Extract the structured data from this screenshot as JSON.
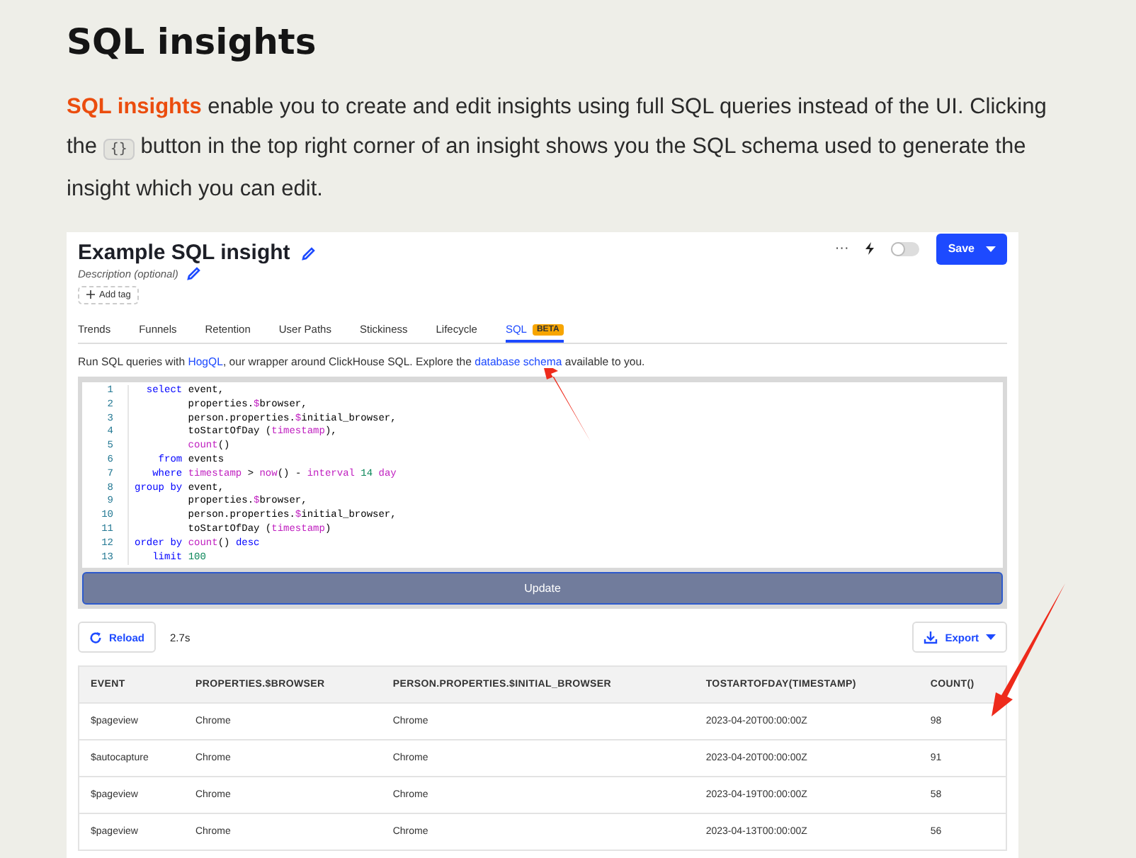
{
  "heading": "SQL insights",
  "intro": {
    "link": "SQL insights",
    "text_1": " enable you to create and edit insights using full SQL queries instead of the UI. Clicking the ",
    "code": "{}",
    "text_2": " button in the top right corner of an insight shows you the SQL schema used to generate the insight which you can edit."
  },
  "insight": {
    "title": "Example SQL insight",
    "description_placeholder": "Description (optional)",
    "add_tag": "Add tag",
    "more": "···",
    "save": "Save",
    "live_toggle": {
      "on": false
    },
    "tabs": [
      {
        "label": "Trends",
        "selected": false
      },
      {
        "label": "Funnels",
        "selected": false
      },
      {
        "label": "Retention",
        "selected": false
      },
      {
        "label": "User Paths",
        "selected": false
      },
      {
        "label": "Stickiness",
        "selected": false
      },
      {
        "label": "Lifecycle",
        "selected": false
      },
      {
        "label": "SQL",
        "badge": "BETA",
        "selected": true
      }
    ],
    "hint": {
      "text_1": "Run SQL queries with ",
      "link_1": "HogQL",
      "text_2": ", our wrapper around ClickHouse SQL. Explore the ",
      "link_2": "database schema",
      "text_3": " available to you."
    },
    "code_lines": [
      {
        "number": "1",
        "tokens": [
          {
            "kind": "kw",
            "text": "  select "
          },
          {
            "kind": "plain",
            "text": "event,"
          }
        ]
      },
      {
        "number": "2",
        "tokens": [
          {
            "kind": "plain",
            "text": "         properties."
          },
          {
            "kind": "fn",
            "text": "$"
          },
          {
            "kind": "plain",
            "text": "browser,"
          }
        ]
      },
      {
        "number": "3",
        "tokens": [
          {
            "kind": "plain",
            "text": "         person.properties."
          },
          {
            "kind": "fn",
            "text": "$"
          },
          {
            "kind": "plain",
            "text": "initial_browser,"
          }
        ]
      },
      {
        "number": "4",
        "tokens": [
          {
            "kind": "plain",
            "text": "         toStartOfDay ("
          },
          {
            "kind": "fn",
            "text": "timestamp"
          },
          {
            "kind": "plain",
            "text": "),"
          }
        ]
      },
      {
        "number": "5",
        "tokens": [
          {
            "kind": "fn",
            "text": "         count"
          },
          {
            "kind": "plain",
            "text": "()"
          }
        ]
      },
      {
        "number": "6",
        "tokens": [
          {
            "kind": "kw",
            "text": "    from "
          },
          {
            "kind": "plain",
            "text": "events"
          }
        ]
      },
      {
        "number": "7",
        "tokens": [
          {
            "kind": "kw",
            "text": "   where "
          },
          {
            "kind": "fn",
            "text": "timestamp"
          },
          {
            "kind": "plain",
            "text": " > "
          },
          {
            "kind": "fn",
            "text": "now"
          },
          {
            "kind": "plain",
            "text": "() - "
          },
          {
            "kind": "fn",
            "text": "interval"
          },
          {
            "kind": "num",
            "text": " 14 "
          },
          {
            "kind": "fn",
            "text": "day"
          }
        ]
      },
      {
        "number": "8",
        "tokens": [
          {
            "kind": "kw",
            "text": "group by "
          },
          {
            "kind": "plain",
            "text": "event,"
          }
        ]
      },
      {
        "number": "9",
        "tokens": [
          {
            "kind": "plain",
            "text": "         properties."
          },
          {
            "kind": "fn",
            "text": "$"
          },
          {
            "kind": "plain",
            "text": "browser,"
          }
        ]
      },
      {
        "number": "10",
        "tokens": [
          {
            "kind": "plain",
            "text": "         person.properties."
          },
          {
            "kind": "fn",
            "text": "$"
          },
          {
            "kind": "plain",
            "text": "initial_browser,"
          }
        ]
      },
      {
        "number": "11",
        "tokens": [
          {
            "kind": "plain",
            "text": "         toStartOfDay ("
          },
          {
            "kind": "fn",
            "text": "timestamp"
          },
          {
            "kind": "plain",
            "text": ")"
          }
        ]
      },
      {
        "number": "12",
        "tokens": [
          {
            "kind": "kw",
            "text": "order by "
          },
          {
            "kind": "fn",
            "text": "count"
          },
          {
            "kind": "plain",
            "text": "() "
          },
          {
            "kind": "kw",
            "text": "desc"
          }
        ]
      },
      {
        "number": "13",
        "tokens": [
          {
            "kind": "kw",
            "text": "   limit "
          },
          {
            "kind": "num",
            "text": "100"
          }
        ]
      }
    ],
    "update": "Update",
    "reload": "Reload",
    "duration": "2.7s",
    "export": "Export",
    "table": {
      "columns": [
        "EVENT",
        "PROPERTIES.$BROWSER",
        "PERSON.PROPERTIES.$INITIAL_BROWSER",
        "TOSTARTOFDAY(TIMESTAMP)",
        "COUNT()"
      ],
      "rows": [
        [
          "$pageview",
          "Chrome",
          "Chrome",
          "2023-04-20T00:00:00Z",
          "98"
        ],
        [
          "$autocapture",
          "Chrome",
          "Chrome",
          "2023-04-20T00:00:00Z",
          "91"
        ],
        [
          "$pageview",
          "Chrome",
          "Chrome",
          "2023-04-19T00:00:00Z",
          "58"
        ],
        [
          "$pageview",
          "Chrome",
          "Chrome",
          "2023-04-13T00:00:00Z",
          "56"
        ]
      ]
    }
  }
}
